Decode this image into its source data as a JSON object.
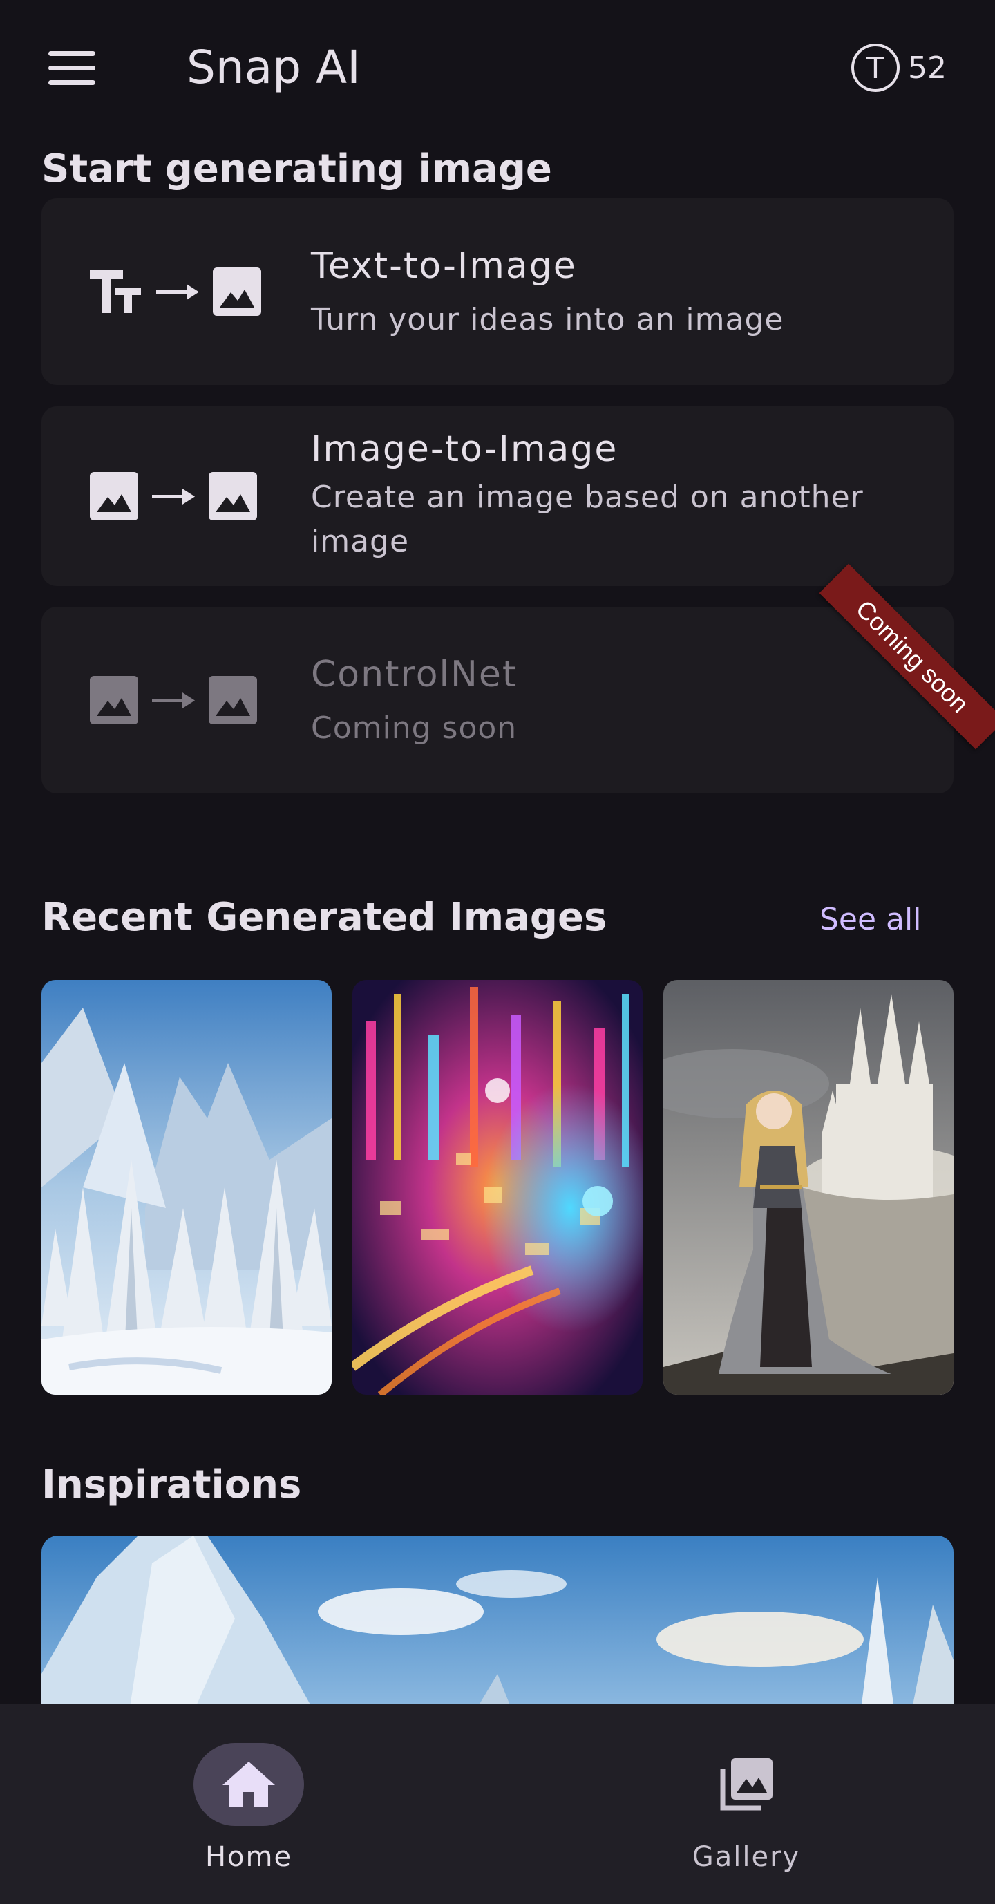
{
  "app": {
    "title": "Snap AI"
  },
  "header": {
    "token_letter": "T",
    "token_count": "52"
  },
  "start_section": {
    "title": "Start generating image"
  },
  "modes": [
    {
      "title": "Text-to-Image",
      "subtitle": "Turn your ideas into an image",
      "icon_left": "text-size-icon",
      "icon_right": "image-icon",
      "enabled": true
    },
    {
      "title": "Image-to-Image",
      "subtitle": "Create an image based on another image",
      "icon_left": "image-icon",
      "icon_right": "image-icon",
      "enabled": true
    },
    {
      "title": "ControlNet",
      "subtitle": "Coming soon",
      "icon_left": "image-icon",
      "icon_right": "image-icon",
      "enabled": false,
      "ribbon": "Coming soon"
    }
  ],
  "recent": {
    "title": "Recent Generated Images",
    "see_all": "See all",
    "images": [
      "snowy-forest",
      "neon-city",
      "knight-castle"
    ]
  },
  "inspirations": {
    "title": "Inspirations",
    "banner": "snowy-mountain-landscape"
  },
  "bottom_nav": [
    {
      "label": "Home",
      "icon": "home-icon",
      "active": true
    },
    {
      "label": "Gallery",
      "icon": "gallery-icon",
      "active": false
    }
  ],
  "colors": {
    "background": "#141218",
    "card": "#1d1b20",
    "accent": "#d0bcff",
    "ribbon": "#7a1a1a",
    "nav_active": "#4a4458"
  }
}
